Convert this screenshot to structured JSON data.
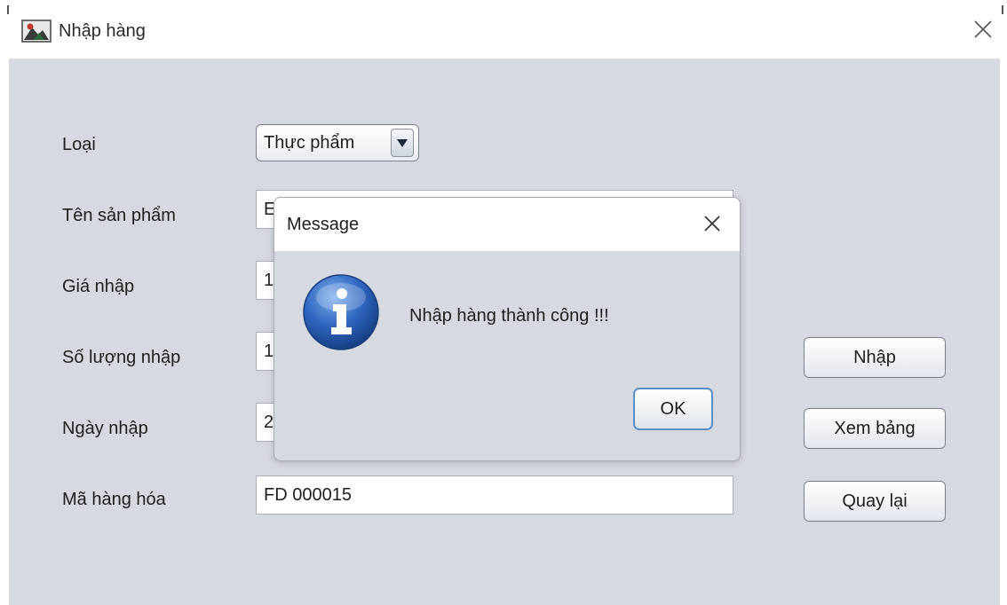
{
  "window": {
    "title": "Nhập hàng",
    "icon": "app-icon",
    "close_icon": "close-icon"
  },
  "form": {
    "type_label": "Loại",
    "type_value": "Thực phẩm",
    "name_label": "Tên sản phẩm",
    "name_value": "E",
    "price_label": "Giá nhập",
    "price_value": "1",
    "quantity_label": "Số lượng nhập",
    "quantity_value": "1",
    "date_label": "Ngày nhập",
    "date_value": "2",
    "code_label": "Mã hàng hóa",
    "code_value": "FD 000015"
  },
  "buttons": {
    "import_label": "Nhập",
    "view_table_label": "Xem bảng",
    "back_label": "Quay lại"
  },
  "dialog": {
    "title": "Message",
    "message": "Nhập hàng thành công !!!",
    "ok_label": "OK",
    "icon": "info-icon"
  },
  "colors": {
    "content_bg": "#d6d9df",
    "info_blue": "#2a5fb0",
    "ok_focus_border": "#5a8fc6"
  }
}
